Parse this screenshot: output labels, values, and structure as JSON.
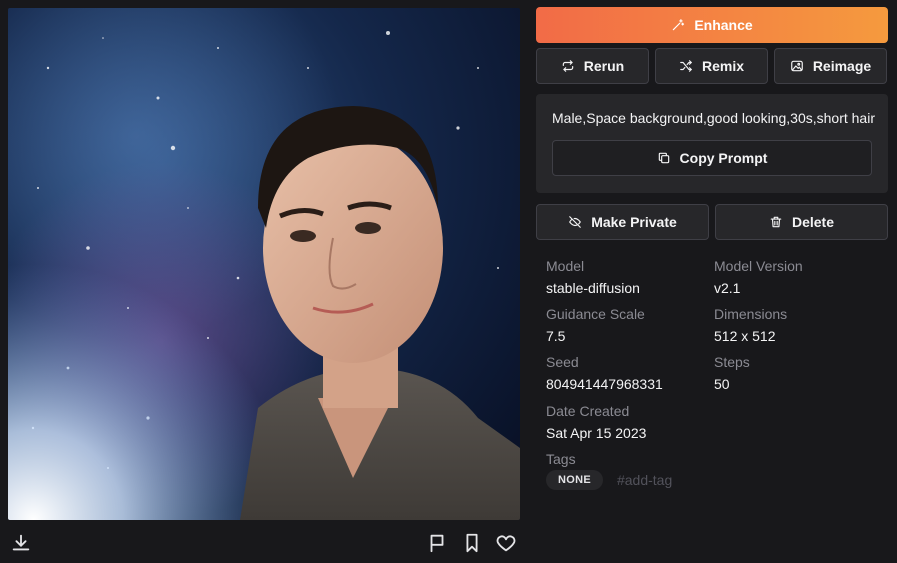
{
  "actions": {
    "enhance": "Enhance",
    "rerun": "Rerun",
    "remix": "Remix",
    "reimage": "Reimage",
    "make_private": "Make Private",
    "delete": "Delete",
    "copy_prompt": "Copy Prompt"
  },
  "prompt": "Male,Space background,good looking,30s,short hair",
  "details": {
    "model_label": "Model",
    "model_value": "stable-diffusion",
    "version_label": "Model Version",
    "version_value": "v2.1",
    "guidance_label": "Guidance Scale",
    "guidance_value": "7.5",
    "dimensions_label": "Dimensions",
    "dimensions_value": "512 x 512",
    "seed_label": "Seed",
    "seed_value": "804941447968331",
    "steps_label": "Steps",
    "steps_value": "50",
    "date_label": "Date Created",
    "date_value": "Sat Apr 15 2023",
    "tags_label": "Tags"
  },
  "tags": {
    "items": [
      "NONE"
    ],
    "add_placeholder": "#add-tag"
  },
  "icons": {
    "enhance": "magic-wand-icon",
    "rerun": "repeat-icon",
    "remix": "shuffle-icon",
    "reimage": "image-icon",
    "copy": "copy-icon",
    "private": "eye-off-icon",
    "delete": "trash-icon",
    "download": "download-icon",
    "report": "flag-icon",
    "bookmark": "bookmark-icon",
    "like": "heart-icon"
  },
  "colors": {
    "background": "#18181b",
    "enhance_gradient_start": "#f26b47",
    "enhance_gradient_end": "#f59a3e",
    "button_bg": "#27272a",
    "label_gray": "#8b8b93"
  }
}
